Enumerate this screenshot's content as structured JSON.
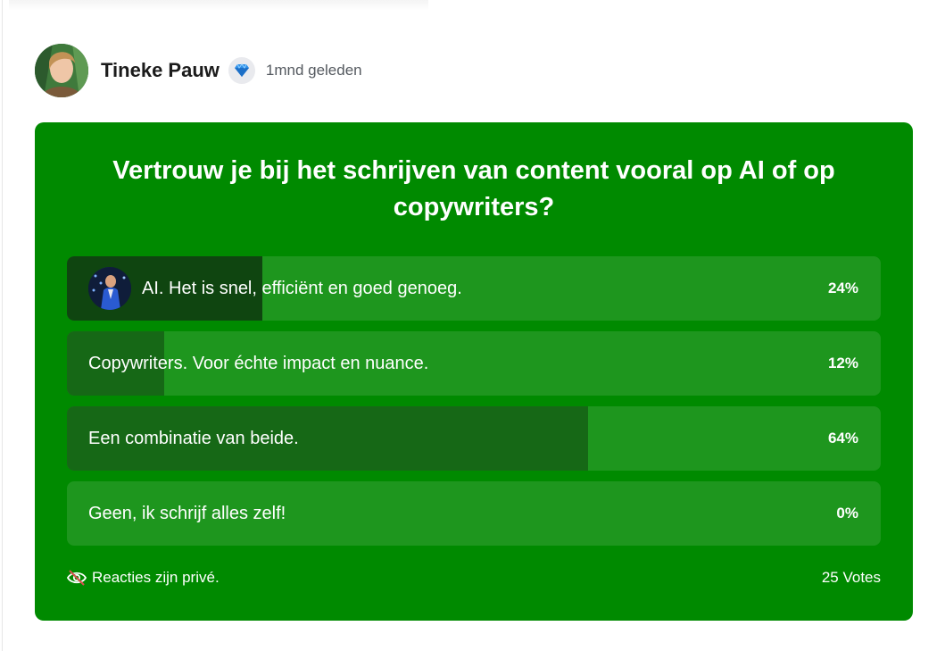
{
  "post": {
    "author": "Tineke Pauw",
    "badge_icon": "diamond-icon",
    "timestamp": "1mnd geleden"
  },
  "poll": {
    "question": "Vertrouw je bij het schrijven van content vooral op AI of op copywriters?",
    "background_color": "#008a00",
    "options": [
      {
        "label": "AI. Het is snel, efficiënt en goed genoeg.",
        "percent_label": "24%",
        "percent": 24,
        "voted": true
      },
      {
        "label": "Copywriters. Voor échte impact en nuance.",
        "percent_label": "12%",
        "percent": 12,
        "voted": false
      },
      {
        "label": "Een combinatie van beide.",
        "percent_label": "64%",
        "percent": 64,
        "voted": false
      },
      {
        "label": "Geen, ik schrijf alles zelf!",
        "percent_label": "0%",
        "percent": 0,
        "voted": false
      }
    ],
    "privacy_icon": "eye-off-icon",
    "privacy_text": "Reacties zijn privé.",
    "votes_text": "25 Votes"
  }
}
